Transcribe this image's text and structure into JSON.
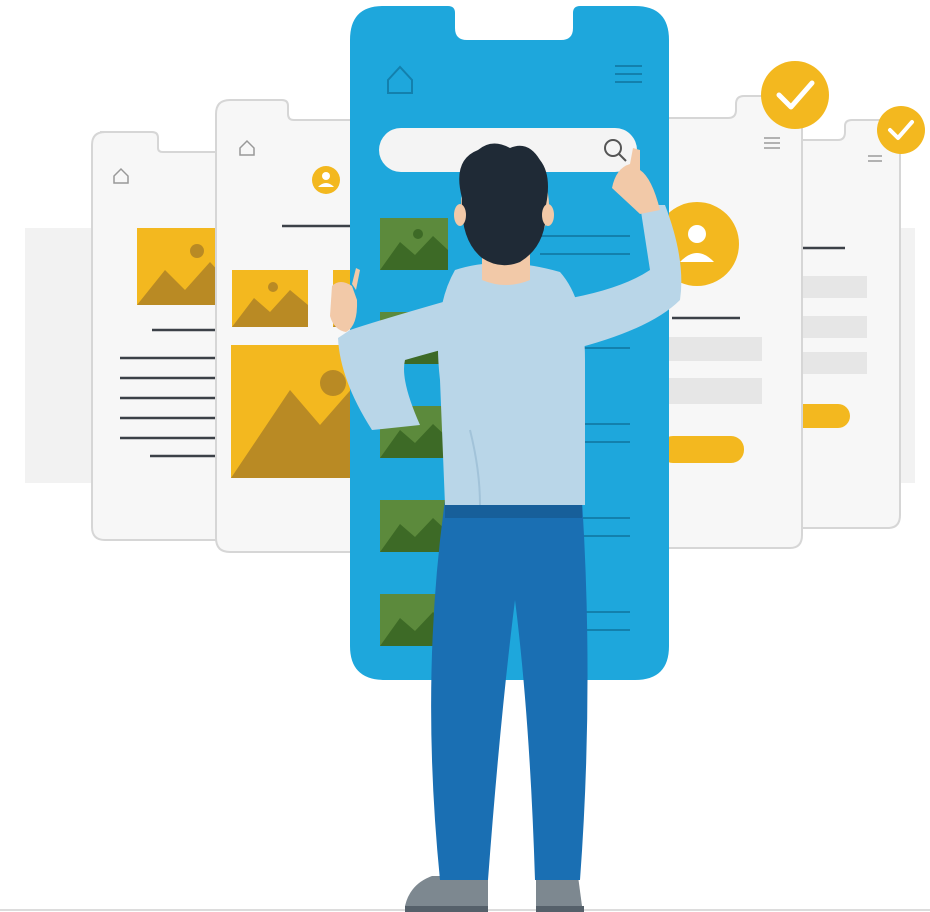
{
  "illustration": {
    "subject": "person-interacting-with-mobile-app-screens",
    "screens": [
      {
        "role": "far-left-screen",
        "icons": [
          "home-icon"
        ],
        "content": [
          "image-placeholder",
          "text-lines"
        ]
      },
      {
        "role": "left-screen",
        "icons": [
          "home-icon",
          "user-icon"
        ],
        "content": [
          "image-placeholder",
          "image-placeholder",
          "image-placeholder",
          "text-lines"
        ]
      },
      {
        "role": "main-phone",
        "icons": [
          "home-icon",
          "hamburger-menu-icon",
          "search-icon"
        ],
        "content": [
          "search-bar",
          "image-list-items"
        ]
      },
      {
        "role": "right-screen",
        "icons": [
          "check-badge-icon",
          "hamburger-menu-icon",
          "user-avatar-icon"
        ],
        "content": [
          "form-fields",
          "submit-button"
        ]
      },
      {
        "role": "far-right-screen",
        "icons": [
          "check-badge-icon",
          "hamburger-menu-icon"
        ],
        "content": [
          "form-fields",
          "submit-button"
        ]
      }
    ],
    "search": {
      "placeholder": ""
    }
  },
  "colors": {
    "phone_blue": "#1ea7dc",
    "accent_yellow": "#f3b81f",
    "thumb_green": "#5c8a3c",
    "shirt": "#b9d6e8",
    "jeans": "#1a6fb3",
    "hair": "#1f2a36",
    "screen_bg": "#f7f7f7",
    "screen_border": "#d6d6d6",
    "line_dark": "#3c4148",
    "field_grey": "#e6e6e6"
  }
}
